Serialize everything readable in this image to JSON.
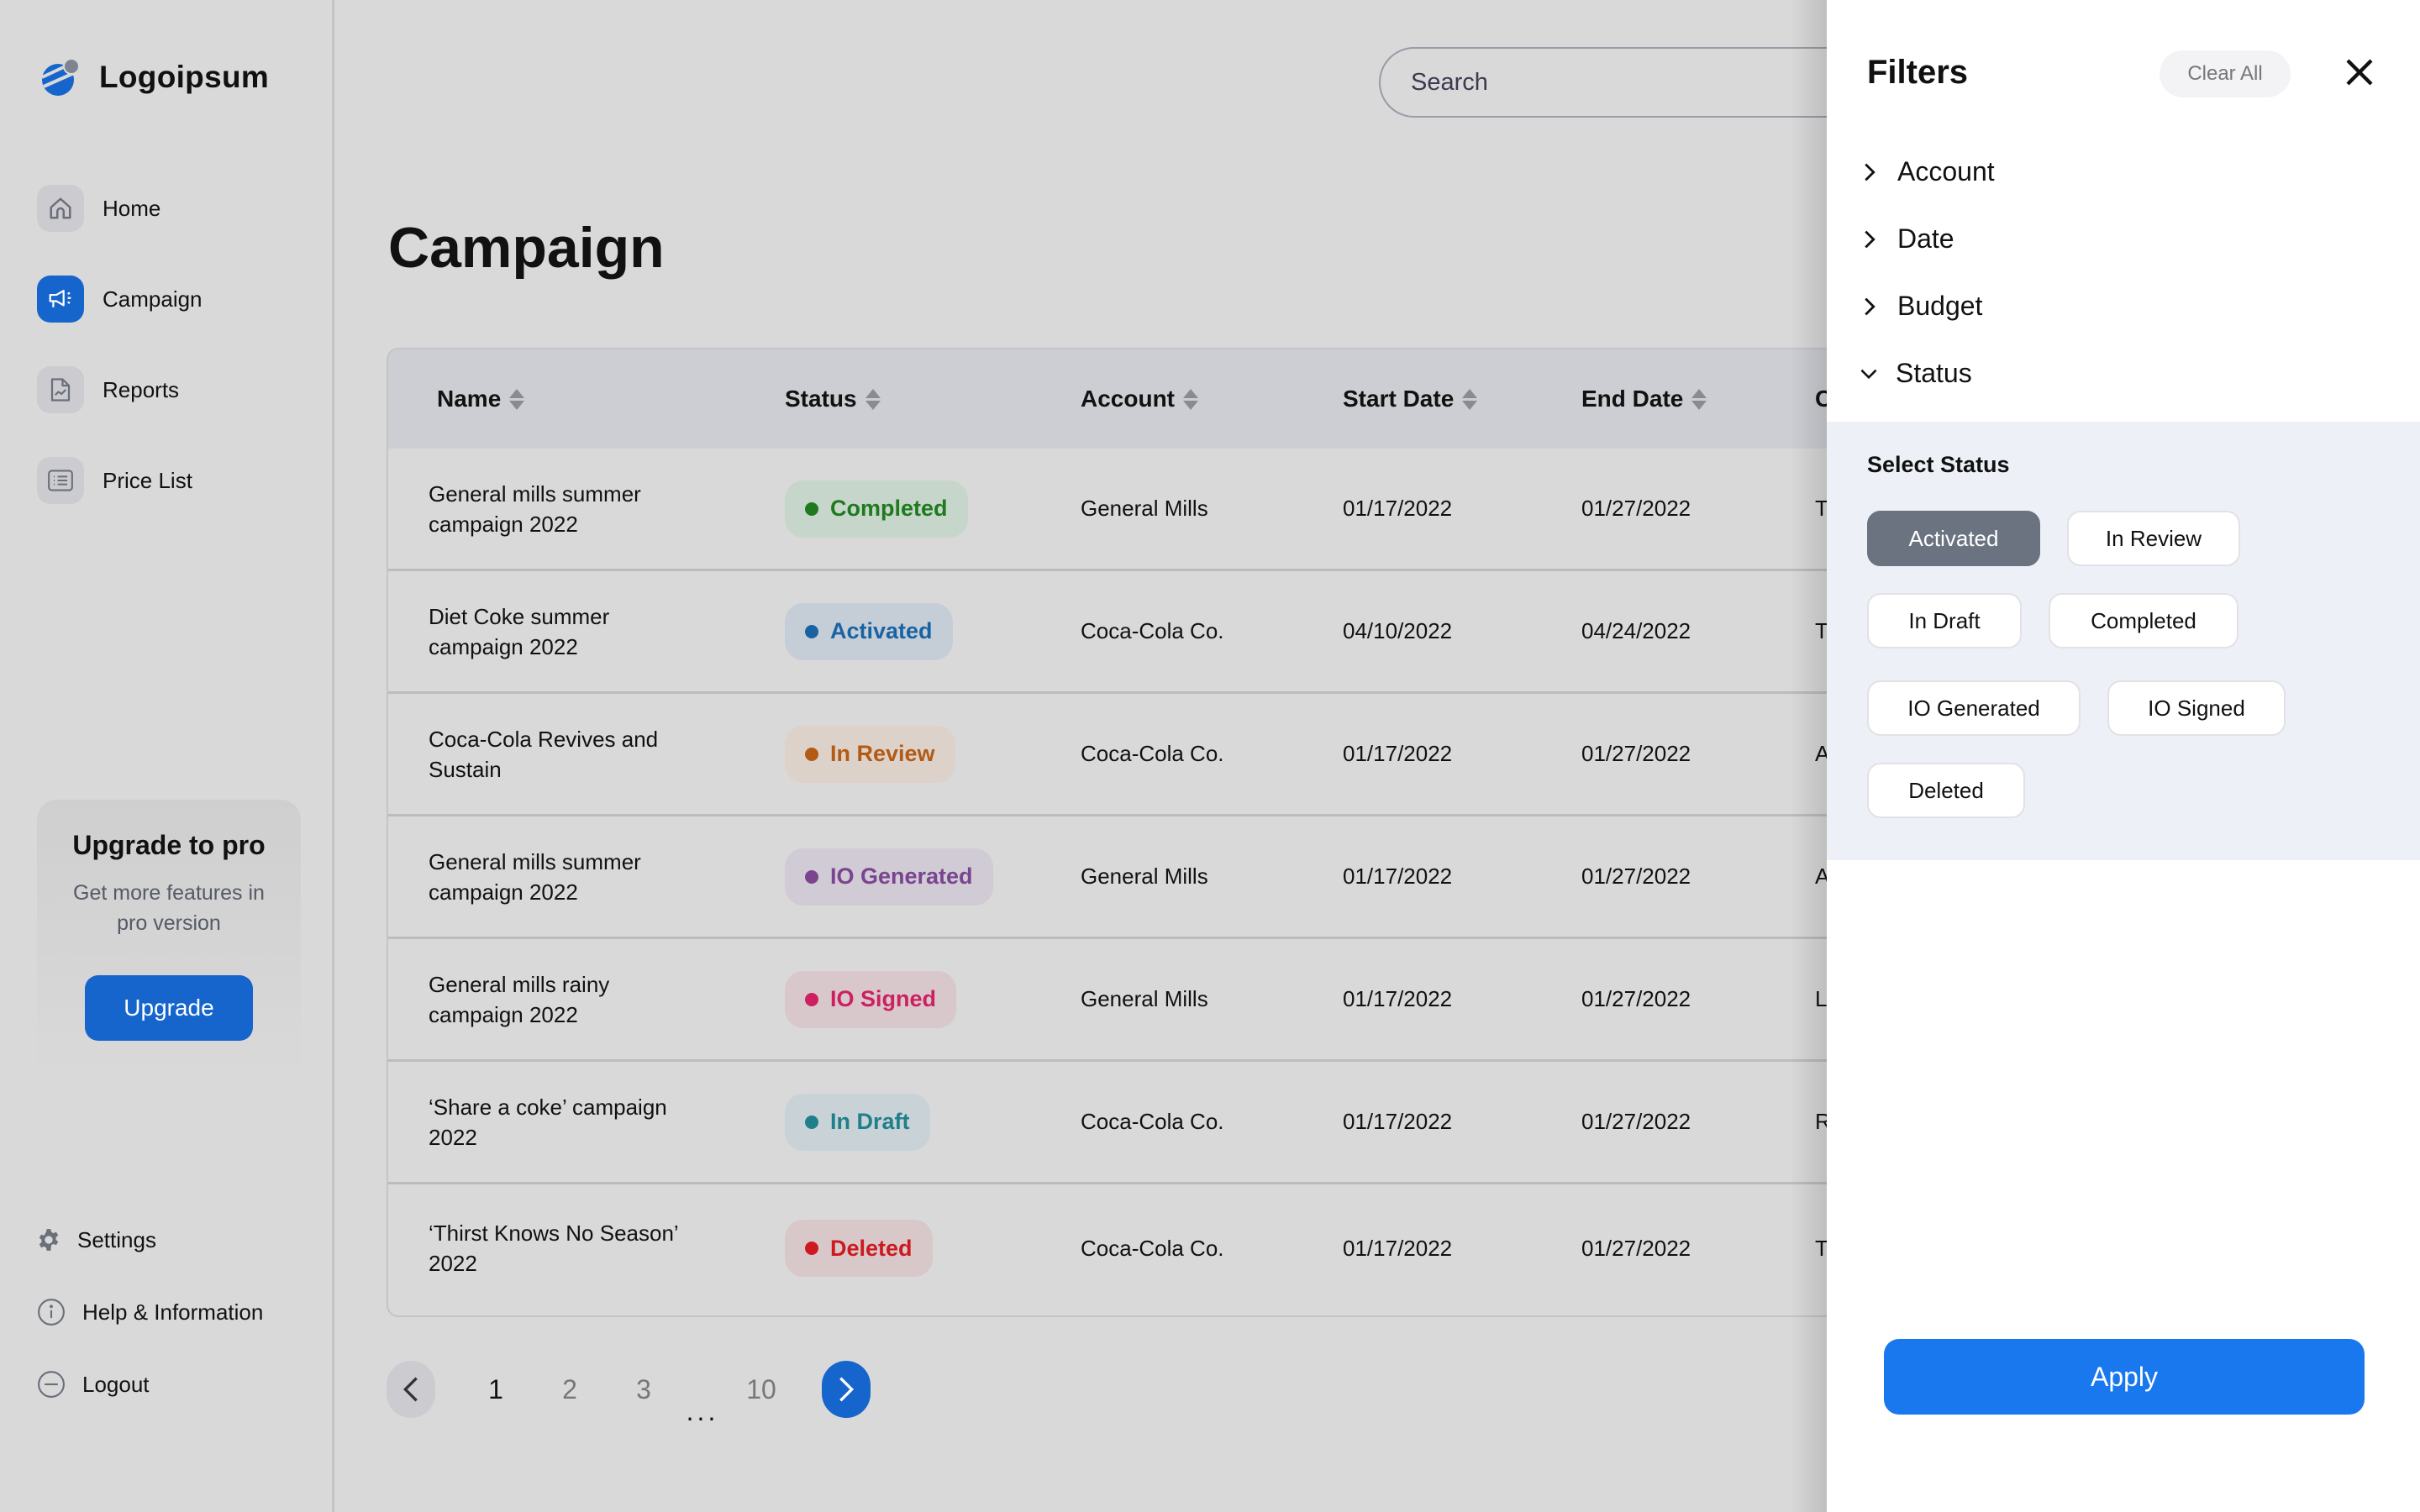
{
  "brand": {
    "name": "Logoipsum",
    "accent": "#1565cc"
  },
  "sidebar": {
    "items": [
      {
        "label": "Home",
        "icon": "home-icon",
        "active": false
      },
      {
        "label": "Campaign",
        "icon": "megaphone-icon",
        "active": true
      },
      {
        "label": "Reports",
        "icon": "report-chart-icon",
        "active": false
      },
      {
        "label": "Price List",
        "icon": "list-icon",
        "active": false
      }
    ],
    "upgrade": {
      "title": "Upgrade to pro",
      "subtitle": "Get more features in pro version",
      "button": "Upgrade"
    },
    "bottom": [
      {
        "label": "Settings",
        "icon": "gear-icon"
      },
      {
        "label": "Help & Information",
        "icon": "info-icon"
      },
      {
        "label": "Logout",
        "icon": "logout-icon"
      }
    ]
  },
  "search": {
    "placeholder": "Search",
    "value": ""
  },
  "page": {
    "title": "Campaign"
  },
  "table": {
    "columns": [
      "Name",
      "Status",
      "Account",
      "Start Date",
      "End Date",
      "C"
    ],
    "rows": [
      {
        "name": "General mills summer campaign 2022",
        "status": "Completed",
        "account": "General Mills",
        "start": "01/17/2022",
        "end": "01/27/2022",
        "extra": "T"
      },
      {
        "name": "Diet Coke summer campaign 2022",
        "status": "Activated",
        "account": "Coca-Cola Co.",
        "start": "04/10/2022",
        "end": "04/24/2022",
        "extra": "T"
      },
      {
        "name": "Coca-Cola Revives and Sustain",
        "status": "In Review",
        "account": "Coca-Cola Co.",
        "start": "01/17/2022",
        "end": "01/27/2022",
        "extra": "A"
      },
      {
        "name": "General mills summer campaign 2022",
        "status": "IO Generated",
        "account": "General Mills",
        "start": "01/17/2022",
        "end": "01/27/2022",
        "extra": "A"
      },
      {
        "name": "General mills rainy campaign 2022",
        "status": "IO Signed",
        "account": "General Mills",
        "start": "01/17/2022",
        "end": "01/27/2022",
        "extra": "L"
      },
      {
        "name": "‘Share a coke’ campaign 2022",
        "status": "In Draft",
        "account": "Coca-Cola Co.",
        "start": "01/17/2022",
        "end": "01/27/2022",
        "extra": "R"
      },
      {
        "name": "‘Thirst Knows No Season’ 2022",
        "status": "Deleted",
        "account": "Coca-Cola Co.",
        "start": "01/17/2022",
        "end": "01/27/2022",
        "extra": "T"
      }
    ]
  },
  "status_colors": {
    "Completed": {
      "fg": "#1f7a1f",
      "bg": "#c7d6cb"
    },
    "Activated": {
      "fg": "#1a63a3",
      "bg": "#c5ced6"
    },
    "In Review": {
      "fg": "#b35a14",
      "bg": "#dcd2ca"
    },
    "IO Generated": {
      "fg": "#7a4490",
      "bg": "#d0cbd4"
    },
    "IO Signed": {
      "fg": "#cc2060",
      "bg": "#d8c8cc"
    },
    "In Draft": {
      "fg": "#1f7f8a",
      "bg": "#c9d3d7"
    },
    "Deleted": {
      "fg": "#cc1a20",
      "bg": "#d8c8ca"
    }
  },
  "pagination": {
    "pages": [
      "1",
      "2",
      "3",
      "10"
    ],
    "ellipsis": "...",
    "current": "1"
  },
  "filters": {
    "title": "Filters",
    "clear_all": "Clear All",
    "facets": [
      {
        "label": "Account",
        "expanded": false
      },
      {
        "label": "Date",
        "expanded": false
      },
      {
        "label": "Budget",
        "expanded": false
      },
      {
        "label": "Status",
        "expanded": true
      }
    ],
    "status": {
      "label": "Select Status",
      "options": [
        {
          "label": "Activated",
          "selected": true
        },
        {
          "label": "In Review",
          "selected": false
        },
        {
          "label": "In Draft",
          "selected": false
        },
        {
          "label": "Completed",
          "selected": false
        },
        {
          "label": "IO Generated",
          "selected": false
        },
        {
          "label": "IO Signed",
          "selected": false
        },
        {
          "label": "Deleted",
          "selected": false
        }
      ]
    },
    "apply": "Apply"
  }
}
